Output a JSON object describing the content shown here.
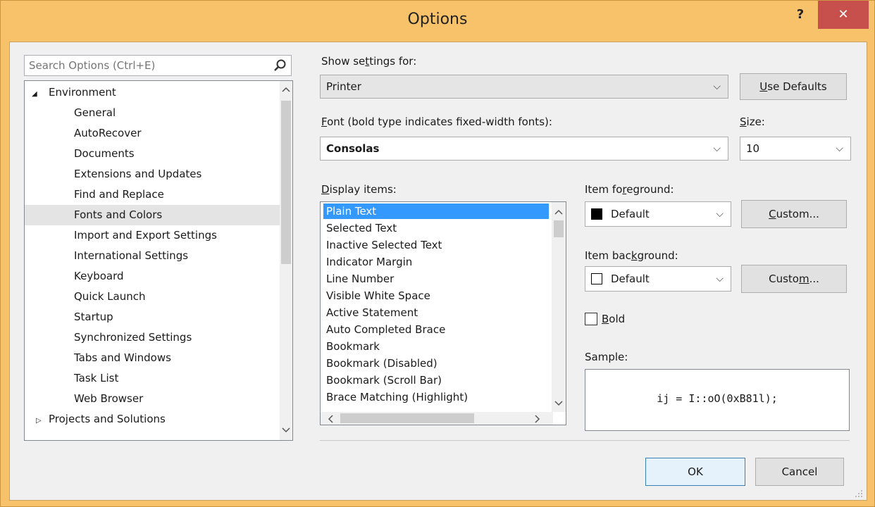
{
  "window": {
    "title": "Options",
    "help": "?",
    "close": "✕"
  },
  "search": {
    "placeholder": "Search Options (Ctrl+E)",
    "value": ""
  },
  "tree": {
    "items": [
      {
        "label": "Environment",
        "expander": "◢"
      },
      {
        "label": "General"
      },
      {
        "label": "AutoRecover"
      },
      {
        "label": "Documents"
      },
      {
        "label": "Extensions and Updates"
      },
      {
        "label": "Find and Replace"
      },
      {
        "label": "Fonts and Colors",
        "selected": true
      },
      {
        "label": "Import and Export Settings"
      },
      {
        "label": "International Settings"
      },
      {
        "label": "Keyboard"
      },
      {
        "label": "Quick Launch"
      },
      {
        "label": "Startup"
      },
      {
        "label": "Synchronized Settings"
      },
      {
        "label": "Tabs and Windows"
      },
      {
        "label": "Task List"
      },
      {
        "label": "Web Browser"
      },
      {
        "label": "Projects and Solutions",
        "expander": "▷"
      }
    ]
  },
  "settings": {
    "show_label_a": "Show se",
    "show_label_u": "t",
    "show_label_b": "tings for:",
    "show_value": "Printer",
    "use_defaults_u": "U",
    "use_defaults_rest": "se Defaults"
  },
  "font": {
    "label_u": "F",
    "label_rest": "ont (bold type indicates fixed-width fonts):",
    "value": "Consolas",
    "size_label_u": "S",
    "size_label_rest": "ize:",
    "size_value": "10"
  },
  "display": {
    "label_u": "D",
    "label_rest": "isplay items:",
    "items": [
      "Plain Text",
      "Selected Text",
      "Inactive Selected Text",
      "Indicator Margin",
      "Line Number",
      "Visible White Space",
      "Active Statement",
      "Auto Completed Brace",
      "Bookmark",
      "Bookmark (Disabled)",
      "Bookmark (Scroll Bar)",
      "Brace Matching (Highlight)"
    ],
    "selected_index": 0
  },
  "foreground": {
    "label_a": "Item fo",
    "label_u": "r",
    "label_b": "eground:",
    "value": "Default",
    "swatch": "#000000",
    "custom_u": "C",
    "custom_rest": "ustom..."
  },
  "background": {
    "label_a": "Item bac",
    "label_u": "k",
    "label_b": "ground:",
    "value": "Default",
    "swatch": "#ffffff",
    "custom_a": "Custo",
    "custom_u": "m",
    "custom_rest": "..."
  },
  "bold": {
    "label_u": "B",
    "label_rest": "old",
    "checked": false
  },
  "sample": {
    "label": "Sample:",
    "text": "ij = I::oO(0xB81l);"
  },
  "buttons": {
    "ok": "OK",
    "cancel": "Cancel"
  },
  "colors": {
    "titlebar": "#f8c26a",
    "close": "#c7504c",
    "selection": "#3399ff"
  }
}
